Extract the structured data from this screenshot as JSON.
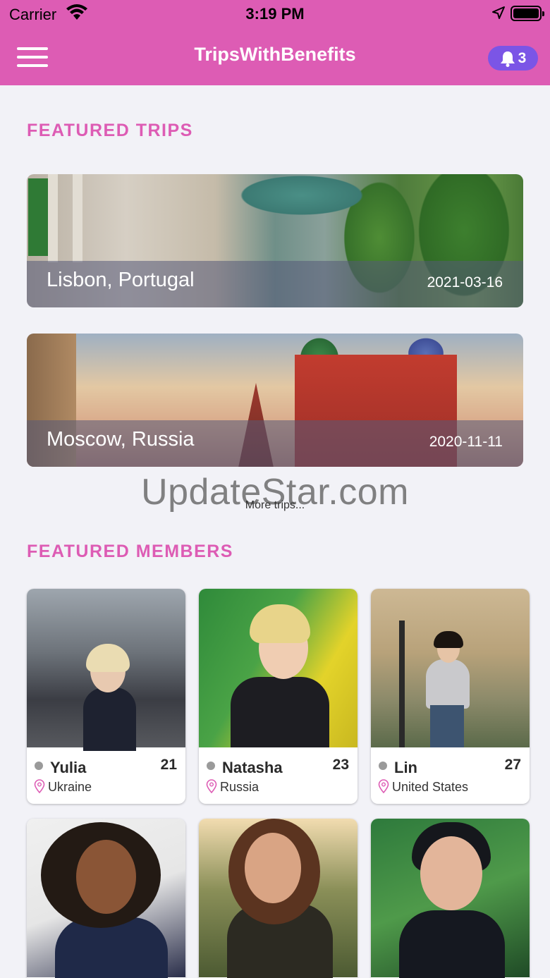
{
  "status_bar": {
    "carrier": "Carrier",
    "time": "3:19 PM"
  },
  "nav": {
    "title": "TripsWithBenefits",
    "notification_count": "3"
  },
  "featured_trips": {
    "heading": "FEATURED TRIPS",
    "items": [
      {
        "city": "Lisbon, Portugal",
        "date": "2021-03-16"
      },
      {
        "city": "Moscow, Russia",
        "date": "2020-11-11"
      }
    ],
    "more_label": "More trips..."
  },
  "watermark": "UpdateStar.com",
  "featured_members": {
    "heading": "FEATURED MEMBERS",
    "items": [
      {
        "name": "Yulia",
        "age": "21",
        "country": "Ukraine"
      },
      {
        "name": "Natasha",
        "age": "23",
        "country": "Russia"
      },
      {
        "name": "Lin",
        "age": "27",
        "country": "United States"
      },
      {
        "name": "",
        "age": "",
        "country": ""
      },
      {
        "name": "",
        "age": "",
        "country": ""
      },
      {
        "name": "",
        "age": "",
        "country": ""
      }
    ]
  },
  "colors": {
    "brand_pink": "#dd5cb4",
    "badge_purple": "#7b55e6",
    "background": "#f2f2f7"
  }
}
